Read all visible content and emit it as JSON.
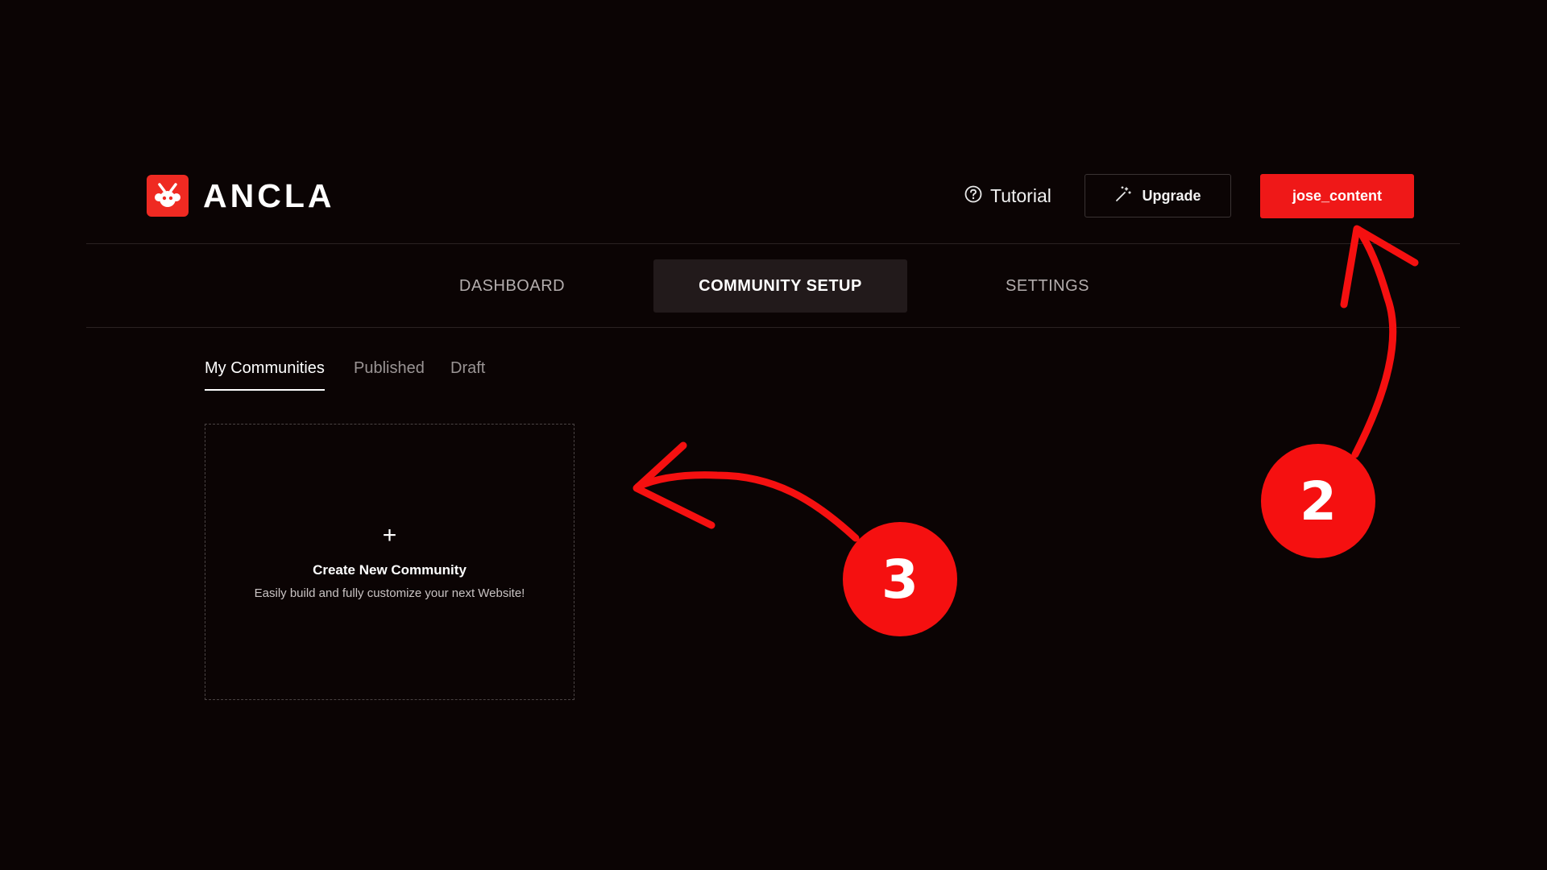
{
  "header": {
    "brand": "ANCLA",
    "tutorial_label": "Tutorial",
    "upgrade_label": "Upgrade",
    "user_label": "jose_content"
  },
  "nav": {
    "items": [
      {
        "label": "DASHBOARD",
        "active": false
      },
      {
        "label": "COMMUNITY SETUP",
        "active": true
      },
      {
        "label": "SETTINGS",
        "active": false
      }
    ]
  },
  "subtabs": {
    "items": [
      {
        "label": "My Communities",
        "active": true
      },
      {
        "label": "Published",
        "active": false
      },
      {
        "label": "Draft",
        "active": false
      }
    ]
  },
  "create_card": {
    "plus": "+",
    "title": "Create New Community",
    "subtitle": "Easily build and fully customize your next Website!"
  },
  "annotations": {
    "step_2": "2",
    "step_3": "3"
  },
  "colors": {
    "background": "#0b0404",
    "accent_red": "#ef1818",
    "active_nav_bg": "#221a1b",
    "muted_text": "#b3adad"
  },
  "icons": {
    "logo": "ancla-logo-icon",
    "tutorial": "question-circle-icon",
    "upgrade": "magic-wand-icon",
    "add": "plus-icon"
  }
}
